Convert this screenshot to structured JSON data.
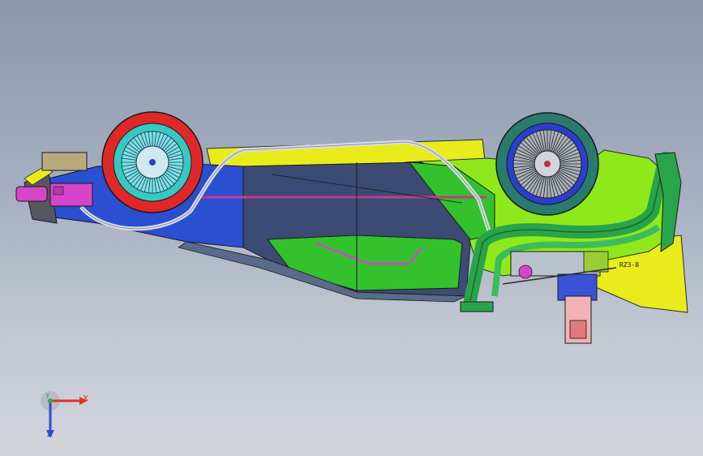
{
  "viewport": {
    "background_top": "#8a97ad",
    "background_bottom": "#d2d5dc"
  },
  "model": {
    "colors": {
      "front_tire": "#e02828",
      "front_rim": "#35c9c2",
      "rear_tire": "#2b7a6e",
      "rear_rim": "#2a3fd0",
      "body_blue": "#2a4fd0",
      "body_navy": "#3b4b73",
      "body_green": "#33c12e",
      "body_lime": "#8fe81a",
      "body_yellow": "#e9ec1a",
      "exhaust_pipe": "#2aa44a",
      "magenta_part": "#d645c9",
      "coolant_pipe": "#d9dde4"
    },
    "part_label": "RZ3-8"
  },
  "triad": {
    "x_label": "X",
    "y_label": "Y",
    "z_label": "Z",
    "x_color": "#e0322a",
    "y_color": "#2fb04a",
    "z_color": "#2f48d8"
  }
}
